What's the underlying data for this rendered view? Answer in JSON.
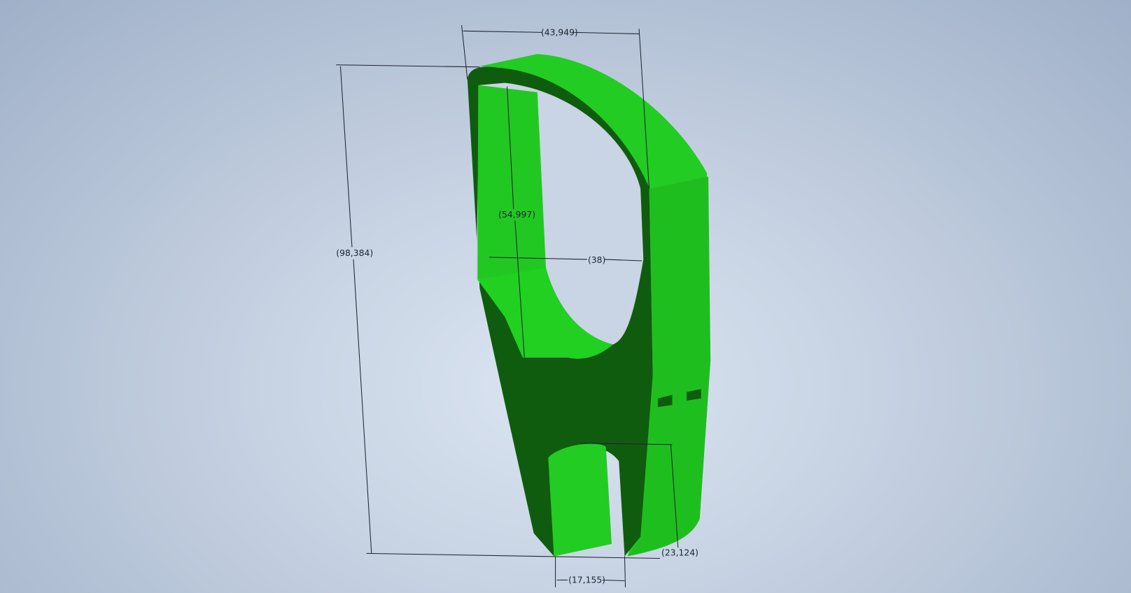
{
  "viewport": {
    "label": "3D model viewport"
  },
  "colors": {
    "light_face": "#22cc22",
    "dark_face": "#0f5c0f",
    "mid_face": "#1aa81a",
    "dimension_line": "#1c2430"
  },
  "dimensions": {
    "overall_width": "(43,949)",
    "overall_height": "(98,384)",
    "inner_height": "(54,997)",
    "inner_width": "(38)",
    "slot_width": "(17,155)",
    "slot_depth": "(23,124)"
  }
}
